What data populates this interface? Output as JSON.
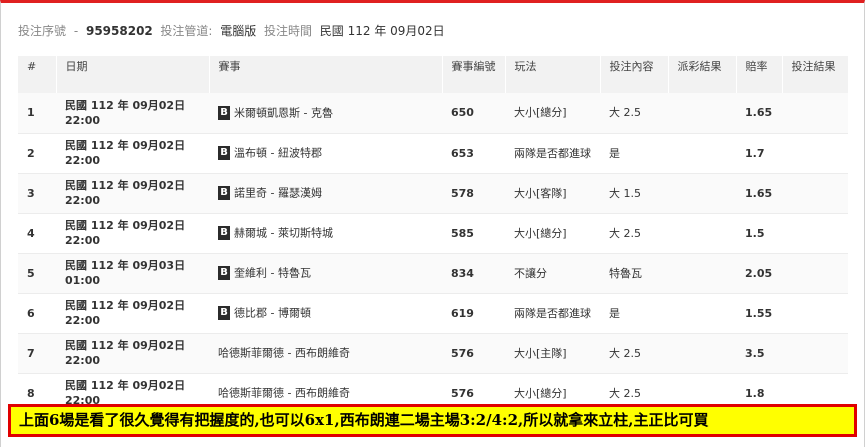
{
  "meta": {
    "serial_label": "投注序號",
    "serial_value": "95958202",
    "channel_label": "投注管道:",
    "channel_value": "電腦版",
    "time_label": "投注時間",
    "time_value": "民國 112 年 09月02日"
  },
  "table": {
    "headers": [
      "#",
      "日期",
      "賽事",
      "賽事編號",
      "玩法",
      "投注內容",
      "派彩結果",
      "賠率",
      "投注結果"
    ],
    "rows": [
      {
        "idx": "1",
        "date": "民國 112 年 09月02日",
        "time": "22:00",
        "badge": "B",
        "match": "米爾頓凱恩斯 - 克魯",
        "code": "650",
        "play": "大小[總分]",
        "content": "大 2.5",
        "payout": "",
        "odds": "1.65",
        "result": ""
      },
      {
        "idx": "2",
        "date": "民國 112 年 09月02日",
        "time": "22:00",
        "badge": "B",
        "match": "溫布頓 - 紐波特郡",
        "code": "653",
        "play": "兩隊是否都進球",
        "content": "是",
        "payout": "",
        "odds": "1.7",
        "result": ""
      },
      {
        "idx": "3",
        "date": "民國 112 年 09月02日",
        "time": "22:00",
        "badge": "B",
        "match": "諾里奇 - 羅瑟漢姆",
        "code": "578",
        "play": "大小[客隊]",
        "content": "大 1.5",
        "payout": "",
        "odds": "1.65",
        "result": ""
      },
      {
        "idx": "4",
        "date": "民國 112 年 09月02日",
        "time": "22:00",
        "badge": "B",
        "match": "赫爾城 - 萊切斯特城",
        "code": "585",
        "play": "大小[總分]",
        "content": "大 2.5",
        "payout": "",
        "odds": "1.5",
        "result": ""
      },
      {
        "idx": "5",
        "date": "民國 112 年 09月03日",
        "time": "01:00",
        "badge": "B",
        "match": "奎維利 - 特魯瓦",
        "code": "834",
        "play": "不讓分",
        "content": "特魯瓦",
        "payout": "",
        "odds": "2.05",
        "result": ""
      },
      {
        "idx": "6",
        "date": "民國 112 年 09月02日",
        "time": "22:00",
        "badge": "B",
        "match": "德比郡 - 博爾頓",
        "code": "619",
        "play": "兩隊是否都進球",
        "content": "是",
        "payout": "",
        "odds": "1.55",
        "result": ""
      },
      {
        "idx": "7",
        "date": "民國 112 年 09月02日",
        "time": "22:00",
        "badge": "",
        "match": "哈德斯菲爾德 - 西布朗維奇",
        "code": "576",
        "play": "大小[主隊]",
        "content": "大 2.5",
        "payout": "",
        "odds": "3.5",
        "result": ""
      },
      {
        "idx": "8",
        "date": "民國 112 年 09月02日",
        "time": "22:00",
        "badge": "",
        "match": "哈德斯菲爾德 - 西布朗維奇",
        "code": "576",
        "play": "大小[總分]",
        "content": "大 2.5",
        "payout": "",
        "odds": "1.8",
        "result": ""
      }
    ]
  },
  "caption": "上面6場是看了很久覺得有把握度的,也可以6x1,西布朗連二場主場3:2/4:2,所以就拿來立柱,主正比可買"
}
